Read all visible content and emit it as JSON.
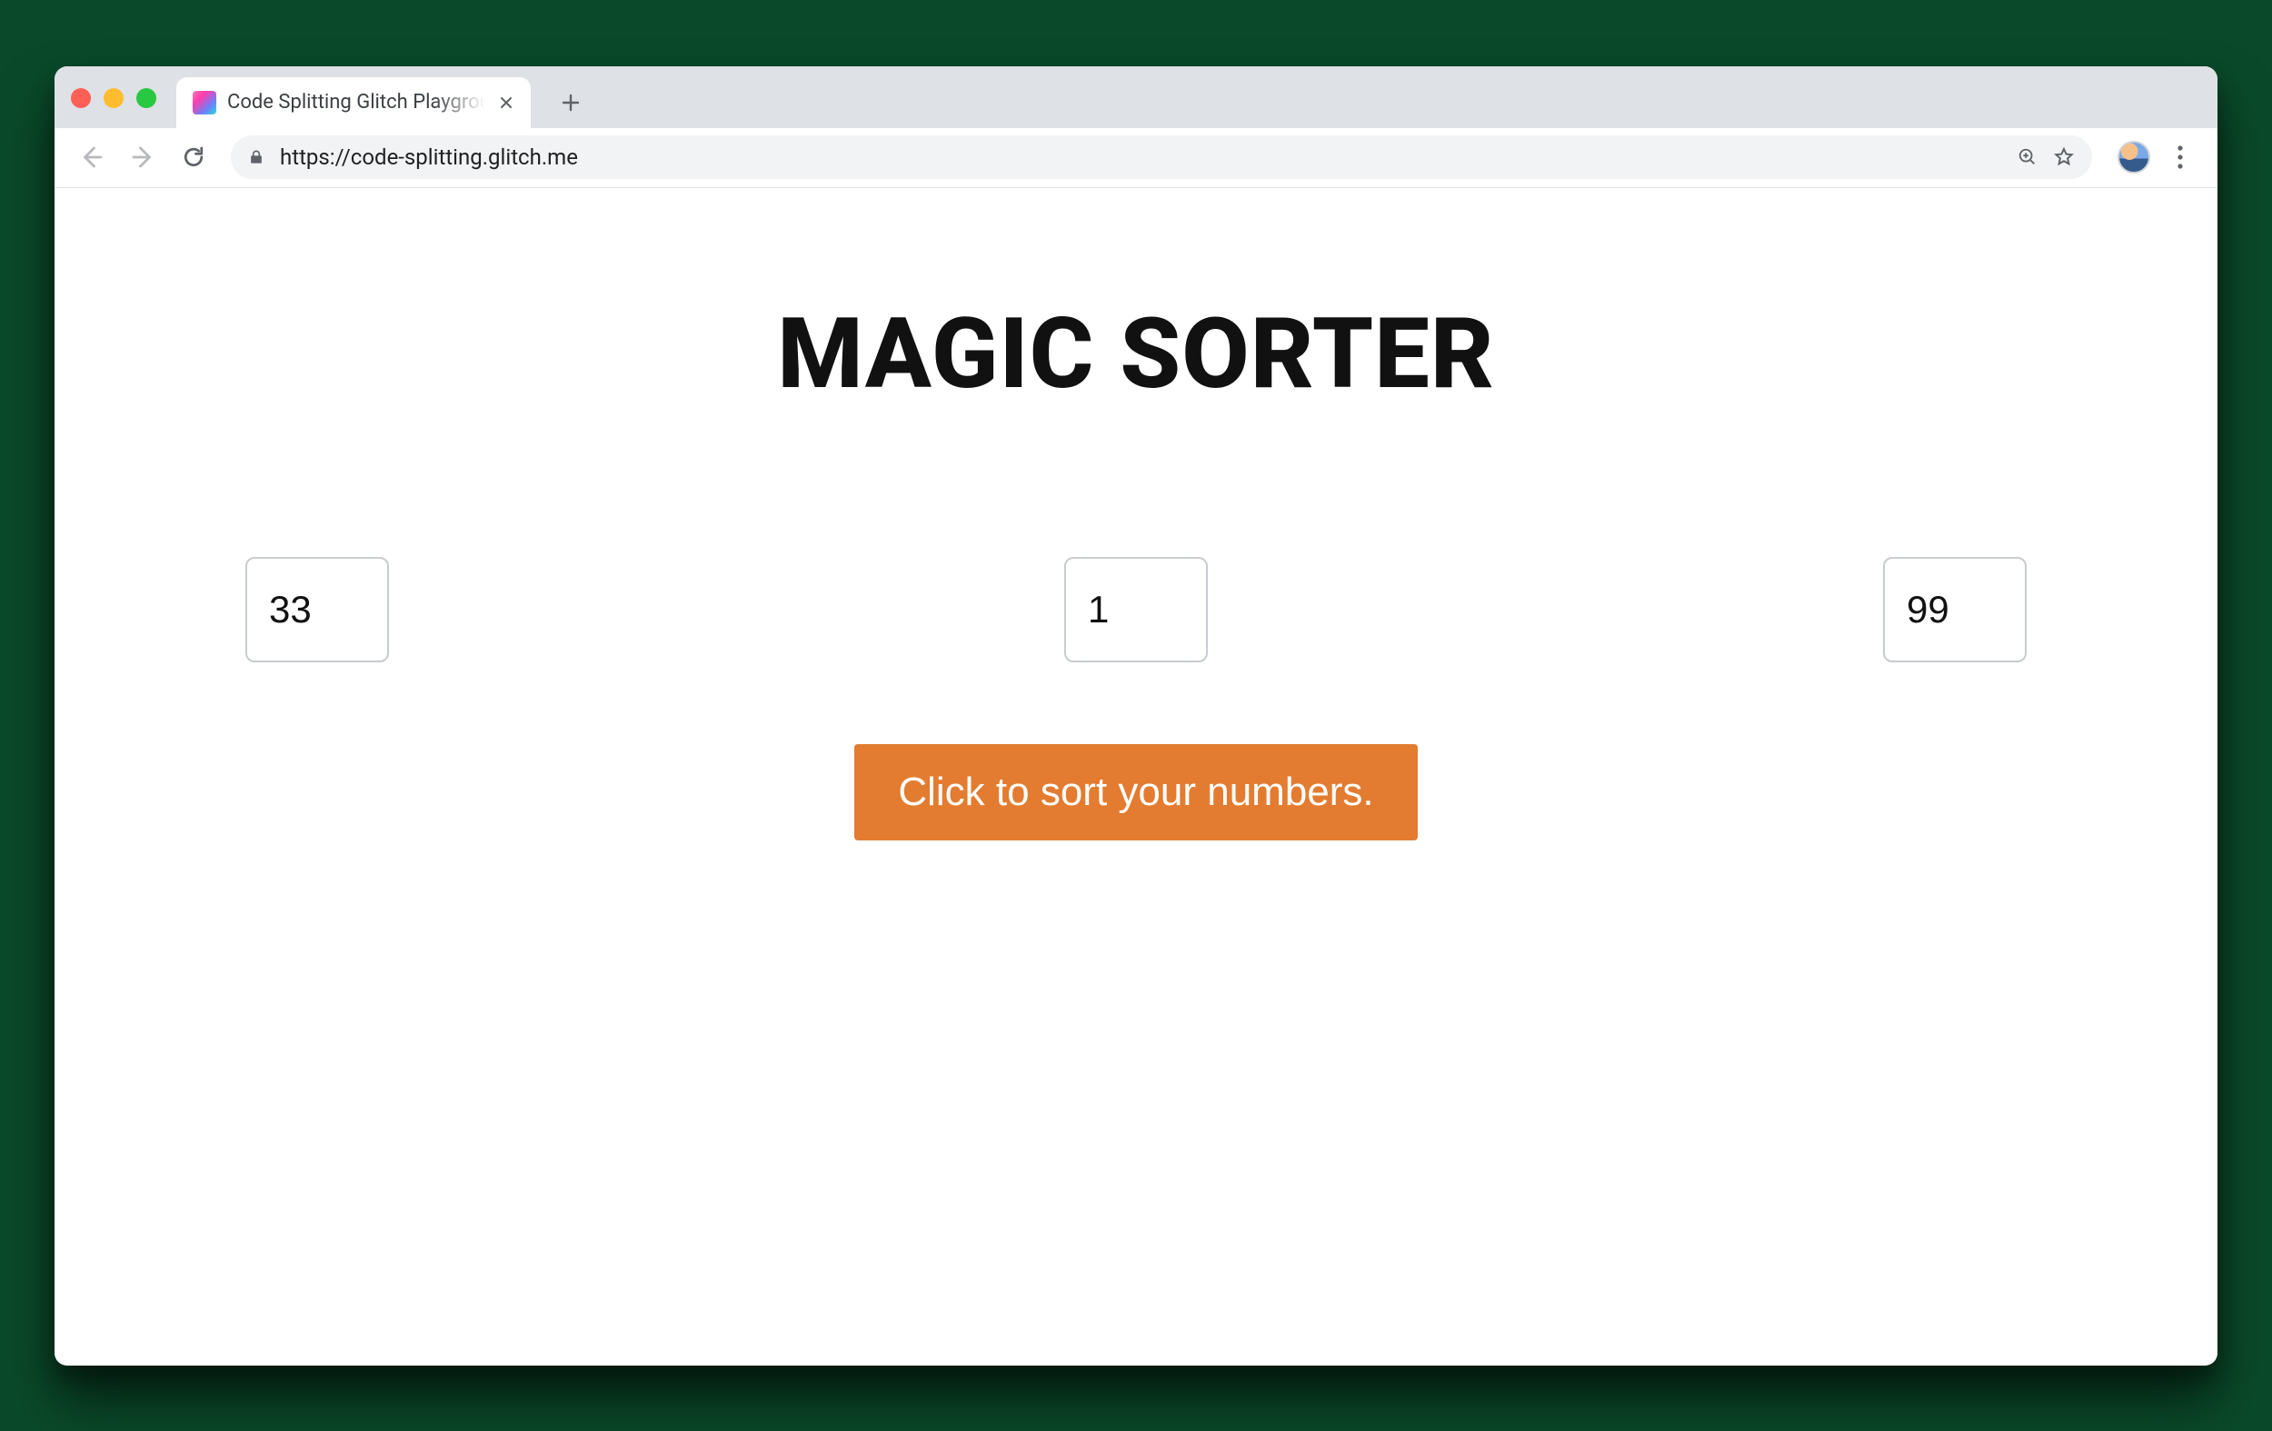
{
  "browser": {
    "tab": {
      "title": "Code Splitting Glitch Playground"
    },
    "url": "https://code-splitting.glitch.me"
  },
  "page": {
    "heading": "MAGIC SORTER",
    "inputs": {
      "a": "33",
      "b": "1",
      "c": "99"
    },
    "button_label": "Click to sort your numbers."
  },
  "colors": {
    "accent": "#e37c30"
  }
}
